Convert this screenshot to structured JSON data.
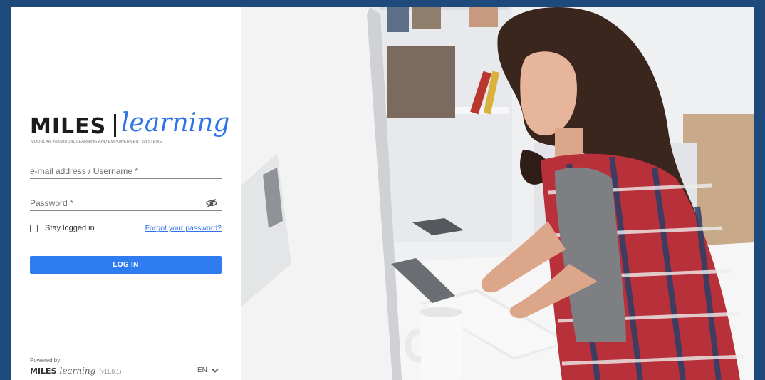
{
  "brand": {
    "name": "MILES",
    "script": "learning",
    "tagline": "MODULAR INDIVIDUAL LEARNING AND EMPOWERMENT SYSTEMS"
  },
  "login": {
    "username_label": "e-mail address / Username *",
    "password_label": "Password *",
    "remember_label": "Stay logged in",
    "remember_checked": false,
    "forgot_label": "Forgot your password?",
    "submit_label": "LOG IN"
  },
  "footer": {
    "powered_by": "Powered by",
    "brand_name": "MILES",
    "brand_script": "learning",
    "version": "(v11.0.1)",
    "language": "EN"
  },
  "colors": {
    "accent": "#2f7bf0",
    "page_background": "#1d4a7a",
    "panel": "#ffffff"
  }
}
